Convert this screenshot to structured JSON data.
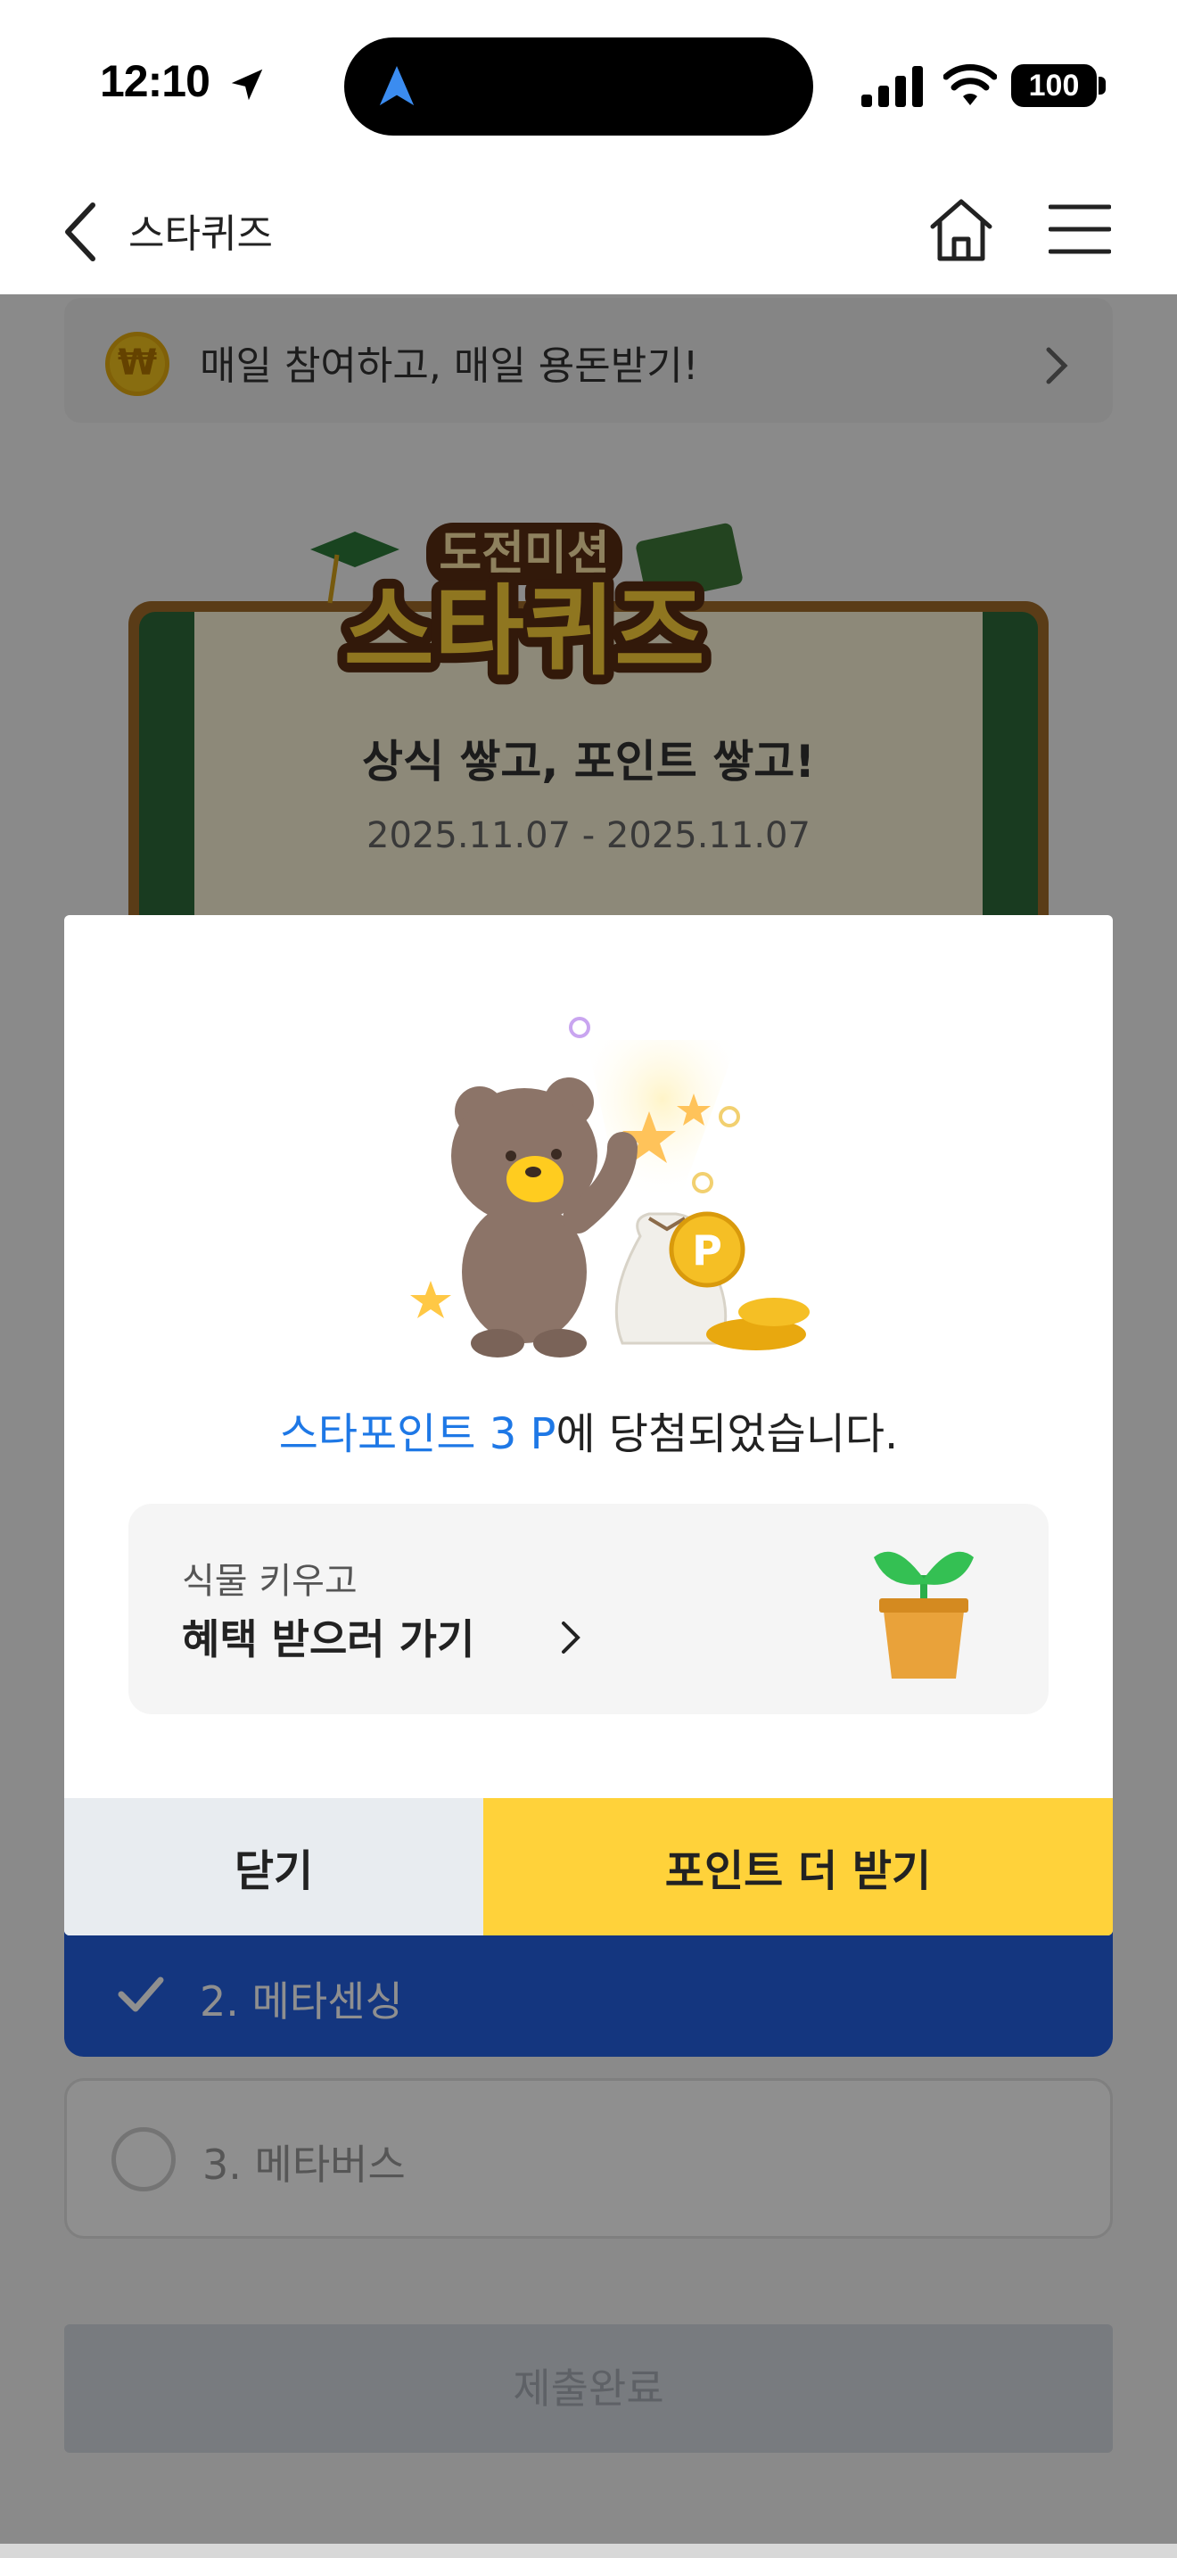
{
  "status_bar": {
    "time": "12:10",
    "battery": "100"
  },
  "nav": {
    "title": "스타퀴즈"
  },
  "banner": {
    "text": "매일 참여하고, 매일 용돈받기!",
    "icon_glyph": "₩"
  },
  "quiz": {
    "logo_top": "도전미션",
    "logo_main": "스타퀴즈",
    "subtitle": "상식 쌓고, 포인트 쌓고!",
    "period": "2025.11.07 - 2025.11.07"
  },
  "options": [
    {
      "label": "2. 메타센싱",
      "selected": true
    },
    {
      "label": "3. 메타버스",
      "selected": false
    }
  ],
  "submit_label": "제출완료",
  "modal": {
    "win_highlight": "스타포인트 3 P",
    "win_rest": "에 당첨되었습니다.",
    "coin_glyph": "P",
    "benefit_sub": "식물 키우고",
    "benefit_main": "혜택 받으러 가기",
    "close_label": "닫기",
    "more_label": "포인트 더 받기"
  },
  "colors": {
    "accent_blue": "#1e78e6",
    "selected_option": "#2460e2",
    "primary_button": "#ffd23a",
    "secondary_button": "#e8ecf0"
  },
  "icons": [
    "location-arrow-icon",
    "navigation-icon",
    "signal-icon",
    "wifi-icon",
    "back-icon",
    "home-icon",
    "menu-icon",
    "won-coin-icon",
    "chevron-right-icon",
    "check-icon",
    "radio-icon",
    "plant-icon"
  ]
}
